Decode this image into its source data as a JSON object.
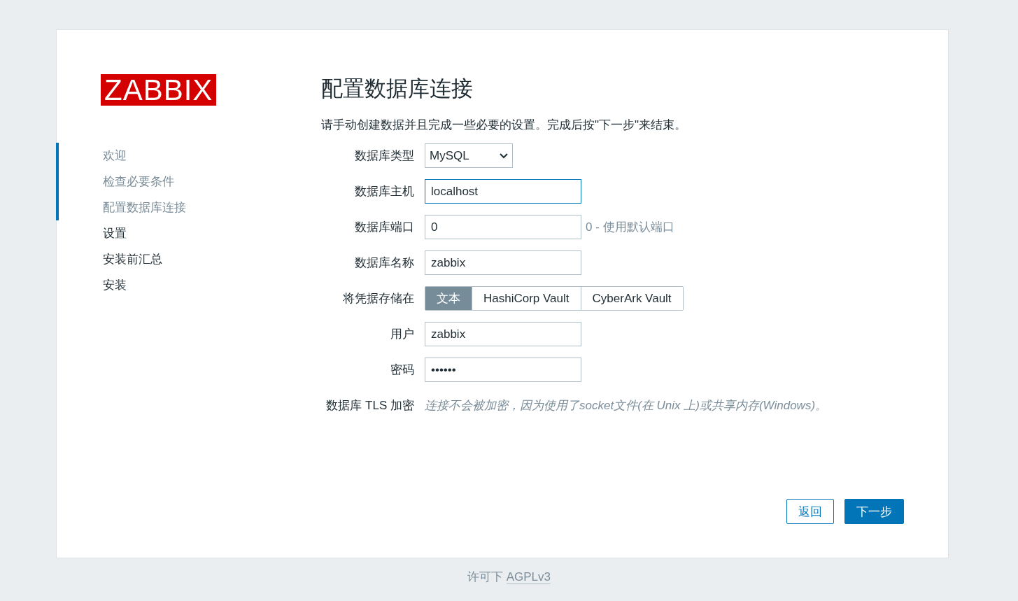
{
  "logo": "ZABBIX",
  "steps": [
    {
      "label": "欢迎",
      "completed": true
    },
    {
      "label": "检查必要条件",
      "completed": true
    },
    {
      "label": "配置数据库连接",
      "completed": true
    },
    {
      "label": "设置",
      "completed": false
    },
    {
      "label": "安装前汇总",
      "completed": false
    },
    {
      "label": "安装",
      "completed": false
    }
  ],
  "title": "配置数据库连接",
  "description": "请手动创建数据并且完成一些必要的设置。完成后按\"下一步\"来结束。",
  "fields": [
    {
      "kind": "select",
      "label": "数据库类型",
      "value": "MySQL"
    },
    {
      "kind": "input",
      "label": "数据库主机",
      "value": "localhost",
      "focused": true
    },
    {
      "kind": "input",
      "label": "数据库端口",
      "value": "0",
      "focused": false,
      "hint": "0 - 使用默认端口"
    },
    {
      "kind": "input",
      "label": "数据库名称",
      "value": "zabbix",
      "focused": false
    },
    {
      "kind": "segmented",
      "label": "将凭据存储在",
      "options": [
        {
          "label": "文本",
          "selected": true
        },
        {
          "label": "HashiCorp Vault",
          "selected": false
        },
        {
          "label": "CyberArk Vault",
          "selected": false
        }
      ]
    },
    {
      "kind": "input",
      "label": "用户",
      "value": "zabbix",
      "focused": false
    },
    {
      "kind": "input",
      "label": "密码",
      "value": "••••••",
      "focused": false
    },
    {
      "kind": "note",
      "label": "数据库 TLS 加密",
      "value": "连接不会被加密，因为使用了socket文件(在 Unix 上)或共享内存(Windows)。"
    }
  ],
  "buttons": [
    {
      "label": "返回",
      "kind": "secondary"
    },
    {
      "label": "下一步",
      "kind": "primary"
    }
  ],
  "footer": {
    "text": "许可下",
    "link": "AGPLv3"
  }
}
